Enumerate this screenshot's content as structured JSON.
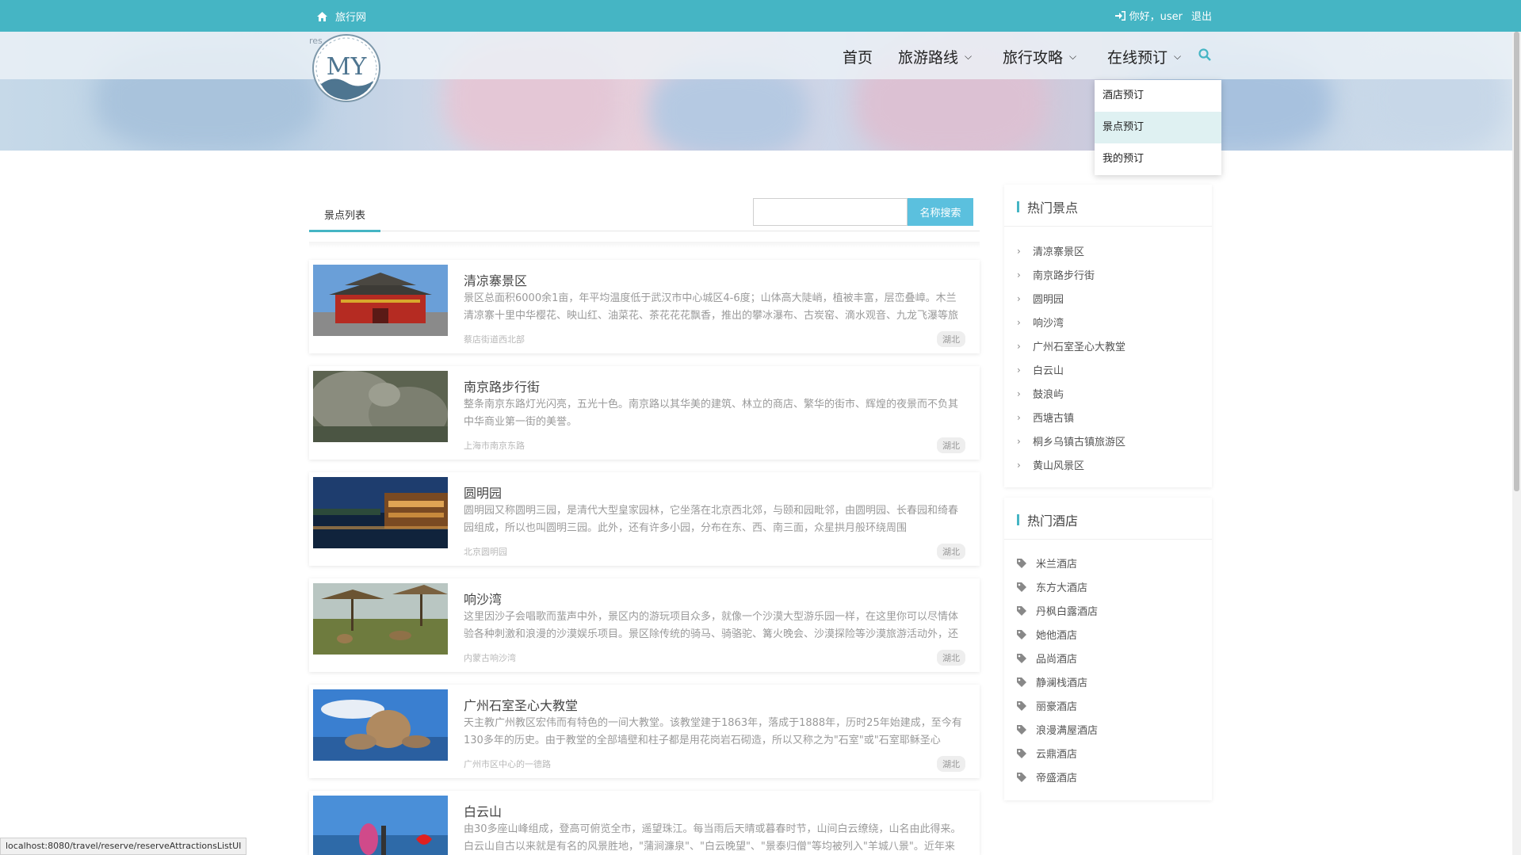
{
  "topbar": {
    "site_name": "旅行网",
    "greeting": "你好，user",
    "logout": "退出"
  },
  "logo": {
    "text": "MY",
    "overlay": "res"
  },
  "nav": {
    "home": "首页",
    "routes": "旅游路线",
    "guides": "旅行攻略",
    "booking": "在线预订"
  },
  "dropdown": {
    "items": [
      "酒店预订",
      "景点预订",
      "我的预订"
    ]
  },
  "list": {
    "tab_label": "景点列表",
    "search_placeholder": "",
    "search_button": "名称搜索",
    "items": [
      {
        "title": "清凉寨景区",
        "desc": "景区总面积6000余1亩，年平均温度低于武汉市中心城区4-6度；山体高大陡峭，植被丰富，层峦叠嶂。木兰清凉寨十里中华樱花、映山红、油菜花、茶花花花飘香，推出的攀冰瀑布、古炭窑、滴水观音、九龙飞瀑等旅游",
        "addr": "蔡店街道西北部",
        "tag": "湖北"
      },
      {
        "title": "南京路步行街",
        "desc": "整条南京东路灯光闪亮，五光十色。南京路以其华美的建筑、林立的商店、繁华的街市、辉煌的夜景而不负其中华商业第一街的美誉。",
        "addr": "上海市南京东路",
        "tag": "湖北"
      },
      {
        "title": "圆明园",
        "desc": "圆明园又称圆明三园，是清代大型皇家园林，它坐落在北京西北郊，与颐和园毗邻，由圆明园、长春园和绮春园组成，所以也叫圆明三园。此外，还有许多小园，分布在东、西、南三面，众星拱月般环绕周围",
        "addr": "北京圆明园",
        "tag": "湖北"
      },
      {
        "title": "响沙湾",
        "desc": "这里因沙子会唱歌而蜚声中外，景区内的游玩项目众多，就像一个沙漠大型游乐园一样，在这里你可以尽情体验各种刺激和浪漫的沙漠娱乐项目。景区除传统的骑马、骑骆驼、篝火晚会、沙漠探险等沙漠旅游活动外，还",
        "addr": "内蒙古响沙湾",
        "tag": "湖北"
      },
      {
        "title": "广州石室圣心大教堂",
        "desc": "天主教广州教区宏伟而有特色的一间大教堂。该教堂建于1863年，落成于1888年，历时25年始建成，至今有130多年的历史。由于教堂的全部墙壁和柱子都是用花岗岩石砌造，所以又称之为\"石室\"或\"石室耶稣圣心",
        "addr": "广州市区中心的一德路",
        "tag": "湖北"
      },
      {
        "title": "白云山",
        "desc": "由30多座山峰组成，登高可俯览全市，遥望珠江。每当雨后天晴或暮春时节，山间白云缭绕，山名由此得来。白云山自古以来就是有名的风景胜地，\"蒲涧濂泉\"、\"白云晚望\"、\"景泰归僧\"等均被列入\"羊城八景\"。近年来又",
        "addr": "",
        "tag": ""
      }
    ]
  },
  "sidebar": {
    "hot_spots_title": "热门景点",
    "hot_spots": [
      "清凉寨景区",
      "南京路步行街",
      "圆明园",
      "响沙湾",
      "广州石室圣心大教堂",
      "白云山",
      "鼓浪屿",
      "西塘古镇",
      "桐乡乌镇古镇旅游区",
      "黄山风景区"
    ],
    "hot_hotels_title": "热门酒店",
    "hot_hotels": [
      "米兰酒店",
      "东方大酒店",
      "丹枫白露酒店",
      "她他酒店",
      "品尚酒店",
      "静澜栈酒店",
      "丽豪酒店",
      "浪漫满屋酒店",
      "云鼎酒店",
      "帝盛酒店"
    ]
  },
  "status_bar": {
    "url": "localhost:8080/travel/reserve/reserveAttractionsListUI"
  },
  "colors": {
    "accent": "#45b5c4",
    "search_button": "#5bc0de",
    "dropdown_active": "#dff1f2"
  }
}
